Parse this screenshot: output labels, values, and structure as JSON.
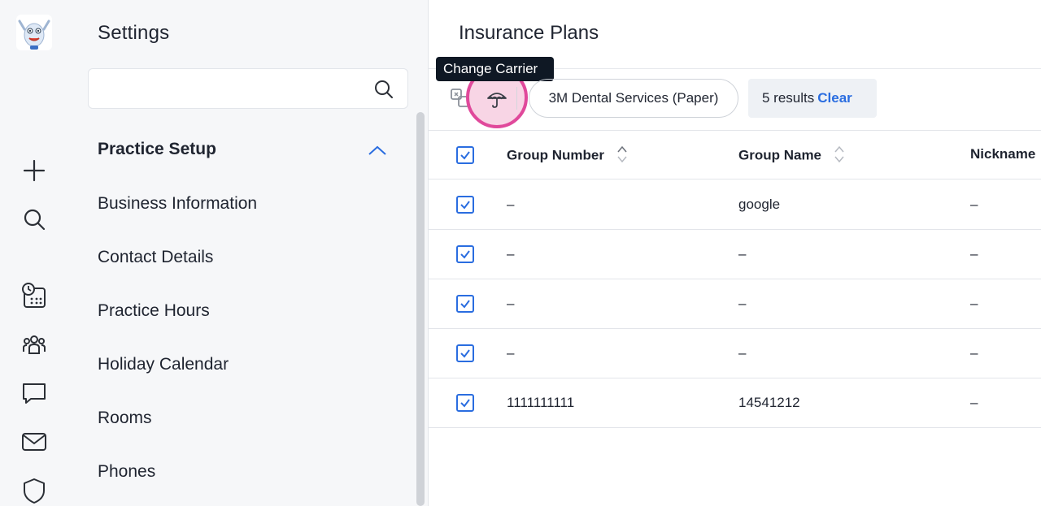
{
  "rail": {
    "icons": [
      "app-logo-mascot",
      "plus-icon",
      "search-icon",
      "calendar-clock-icon",
      "people-group-icon",
      "chat-bubble-icon",
      "mail-icon",
      "shield-icon"
    ]
  },
  "settings": {
    "title": "Settings",
    "search_placeholder": "",
    "section": "Practice Setup",
    "items": [
      {
        "label": "Business Information"
      },
      {
        "label": "Contact Details"
      },
      {
        "label": "Practice Hours"
      },
      {
        "label": "Holiday Calendar"
      },
      {
        "label": "Rooms"
      },
      {
        "label": "Phones"
      }
    ]
  },
  "main": {
    "title": "Insurance Plans",
    "tooltip": "Change Carrier",
    "carrier_chip": "3M Dental Services (Paper)",
    "results_text": "5 results",
    "clear_label": "Clear",
    "columns": [
      "Group Number",
      "Group Name",
      "Nickname"
    ],
    "rows": [
      {
        "group_number": "–",
        "group_name": "google",
        "nickname": "–",
        "checked": true
      },
      {
        "group_number": "–",
        "group_name": "–",
        "nickname": "–",
        "checked": true
      },
      {
        "group_number": "–",
        "group_name": "–",
        "nickname": "–",
        "checked": true
      },
      {
        "group_number": "–",
        "group_name": "–",
        "nickname": "–",
        "checked": true
      },
      {
        "group_number": "1111111111",
        "group_name": "14541212",
        "nickname": "–",
        "checked": true
      }
    ]
  },
  "colors": {
    "accent": "#2a6de0",
    "highlight": "#e0499b",
    "panel_bg": "#f6f7f9"
  }
}
